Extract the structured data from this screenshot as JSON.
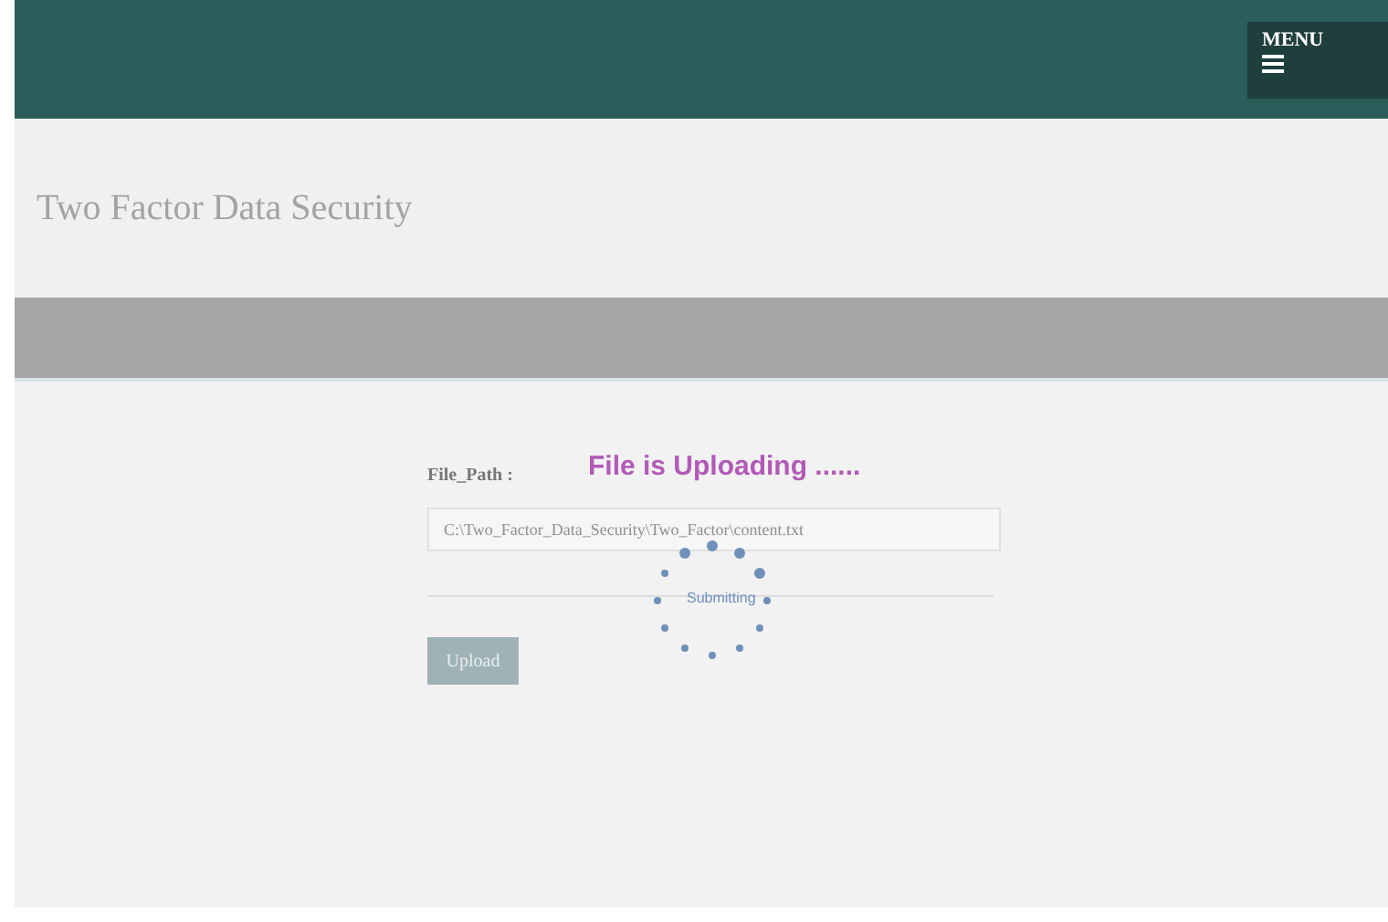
{
  "header": {
    "menu_label": "MENU"
  },
  "title": "Two Factor Data Security",
  "form": {
    "label": "File_Path :",
    "value": "C:\\Two_Factor_Data_Security\\Two_Factor\\content.txt",
    "button": "Upload"
  },
  "overlay": {
    "message": "File is Uploading ......",
    "spinner_text": "Submitting"
  }
}
